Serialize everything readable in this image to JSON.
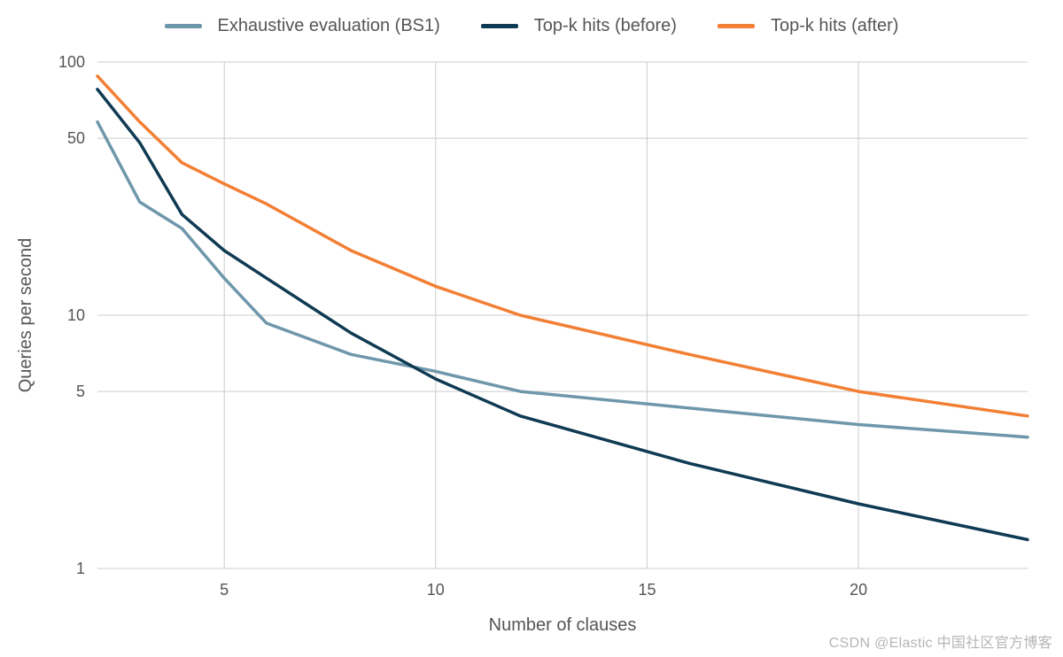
{
  "chart_data": {
    "type": "line",
    "xlabel": "Number of clauses",
    "ylabel": "Queries per second",
    "xlim": [
      2,
      24
    ],
    "ylim": [
      1,
      100
    ],
    "yscale": "log",
    "y_ticks": [
      1,
      5,
      10,
      50,
      100
    ],
    "x_ticks": [
      5,
      10,
      15,
      20
    ],
    "x": [
      2,
      3,
      4,
      5,
      6,
      8,
      10,
      12,
      16,
      20,
      24
    ],
    "series": [
      {
        "name": "Exhaustive evaluation (BS1)",
        "color": "#6f97ab",
        "values": [
          58,
          28,
          22,
          14,
          9.3,
          7,
          6,
          5,
          4.3,
          3.7,
          3.3
        ]
      },
      {
        "name": "Top-k hits (before)",
        "color": "#0f3a53",
        "values": [
          78,
          48,
          25,
          18,
          14,
          8.5,
          5.6,
          4,
          2.6,
          1.8,
          1.3
        ]
      },
      {
        "name": "Top-k hits (after)",
        "color": "#f27f34",
        "values": [
          88,
          58,
          40,
          33,
          27.5,
          18,
          13,
          10,
          7,
          5,
          4
        ]
      }
    ]
  },
  "watermark": "CSDN @Elastic 中国社区官方博客"
}
